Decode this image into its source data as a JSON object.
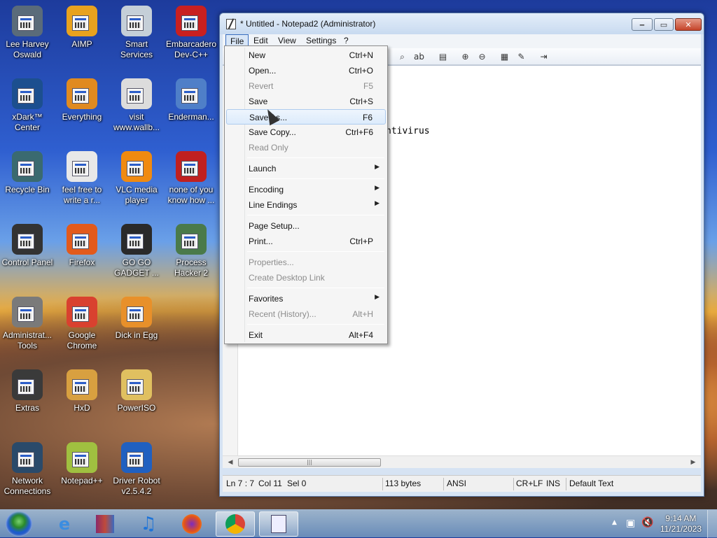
{
  "desktop": {
    "icons": [
      {
        "label": "Lee Harvey\nOswald",
        "color": "#5a6b7a"
      },
      {
        "label": "AIMP",
        "color": "#e8a21e"
      },
      {
        "label": "Smart\nServices",
        "color": "#c5cfd8"
      },
      {
        "label": "Embarcadero\nDev-C++",
        "color": "#c82020"
      },
      {
        "label": "xDark™\nCenter",
        "color": "#1c4f8f"
      },
      {
        "label": "Everything",
        "color": "#e08a20"
      },
      {
        "label": "visit\nwww.wallb...",
        "color": "#dcdcdc"
      },
      {
        "label": "Enderman...",
        "color": "#4f7fc8"
      },
      {
        "label": "Recycle Bin",
        "color": "#3a6a70"
      },
      {
        "label": "feel free to\nwrite a r...",
        "color": "#e8e8e8"
      },
      {
        "label": "VLC media\nplayer",
        "color": "#f08a10"
      },
      {
        "label": "none of you\nknow how ...",
        "color": "#c02020"
      },
      {
        "label": "Control Panel",
        "color": "#333333"
      },
      {
        "label": "Firefox",
        "color": "#e25a1c"
      },
      {
        "label": "GO GO\nGADGET ...",
        "color": "#2a2a2a"
      },
      {
        "label": "Process\nHacker 2",
        "color": "#4a7a4a"
      },
      {
        "label": "Administrat...\nTools",
        "color": "#7a7a7a"
      },
      {
        "label": "Google\nChrome",
        "color": "#d9412f"
      },
      {
        "label": "Dick in Egg",
        "color": "#e8902a"
      },
      {
        "label": "Extras",
        "color": "#3a3a3a"
      },
      {
        "label": "HxD",
        "color": "#d8a040"
      },
      {
        "label": "PowerISO",
        "color": "#e0c060"
      },
      {
        "label": "Network\nConnections",
        "color": "#2a4a6a"
      },
      {
        "label": "Notepad++",
        "color": "#a0c040"
      },
      {
        "label": "Driver Robot\nv2.5.4.2",
        "color": "#2060c0"
      }
    ]
  },
  "window": {
    "title": "* Untitled - Notepad2 (Administrator)",
    "menu": [
      "File",
      "Edit",
      "View",
      "Settings",
      "?"
    ],
    "editor_text": "ntivirus",
    "status": {
      "position": "Ln 7 : 7",
      "column": "Col 11",
      "selection": "Sel 0",
      "size": "113 bytes",
      "encoding": "ANSI",
      "line_endings": "CR+LF",
      "insert_mode": "INS",
      "scheme": "Default Text"
    }
  },
  "file_menu": {
    "items": [
      {
        "label": "New",
        "key": "Ctrl+N",
        "disabled": false
      },
      {
        "label": "Open...",
        "key": "Ctrl+O",
        "disabled": false
      },
      {
        "label": "Revert",
        "key": "F5",
        "disabled": true
      },
      {
        "label": "Save",
        "key": "Ctrl+S",
        "disabled": false
      },
      {
        "label": "Save As...",
        "key": "F6",
        "disabled": false,
        "hover": true
      },
      {
        "label": "Save Copy...",
        "key": "Ctrl+F6",
        "disabled": false
      },
      {
        "label": "Read Only",
        "key": "",
        "disabled": true
      },
      {
        "label": "Launch",
        "key": "",
        "submenu": true
      },
      {
        "label": "Encoding",
        "key": "",
        "submenu": true
      },
      {
        "label": "Line Endings",
        "key": "",
        "submenu": true
      },
      {
        "label": "Page Setup...",
        "key": ""
      },
      {
        "label": "Print...",
        "key": "Ctrl+P"
      },
      {
        "label": "Properties...",
        "key": "",
        "disabled": true
      },
      {
        "label": "Create Desktop Link",
        "key": "",
        "disabled": true
      },
      {
        "label": "Favorites",
        "key": "",
        "submenu": true
      },
      {
        "label": "Recent (History)...",
        "key": "Alt+H",
        "disabled": true
      },
      {
        "label": "Exit",
        "key": "Alt+F4"
      }
    ]
  },
  "taskbar": {
    "time": "9:14 AM",
    "date": "11/21/2023"
  }
}
